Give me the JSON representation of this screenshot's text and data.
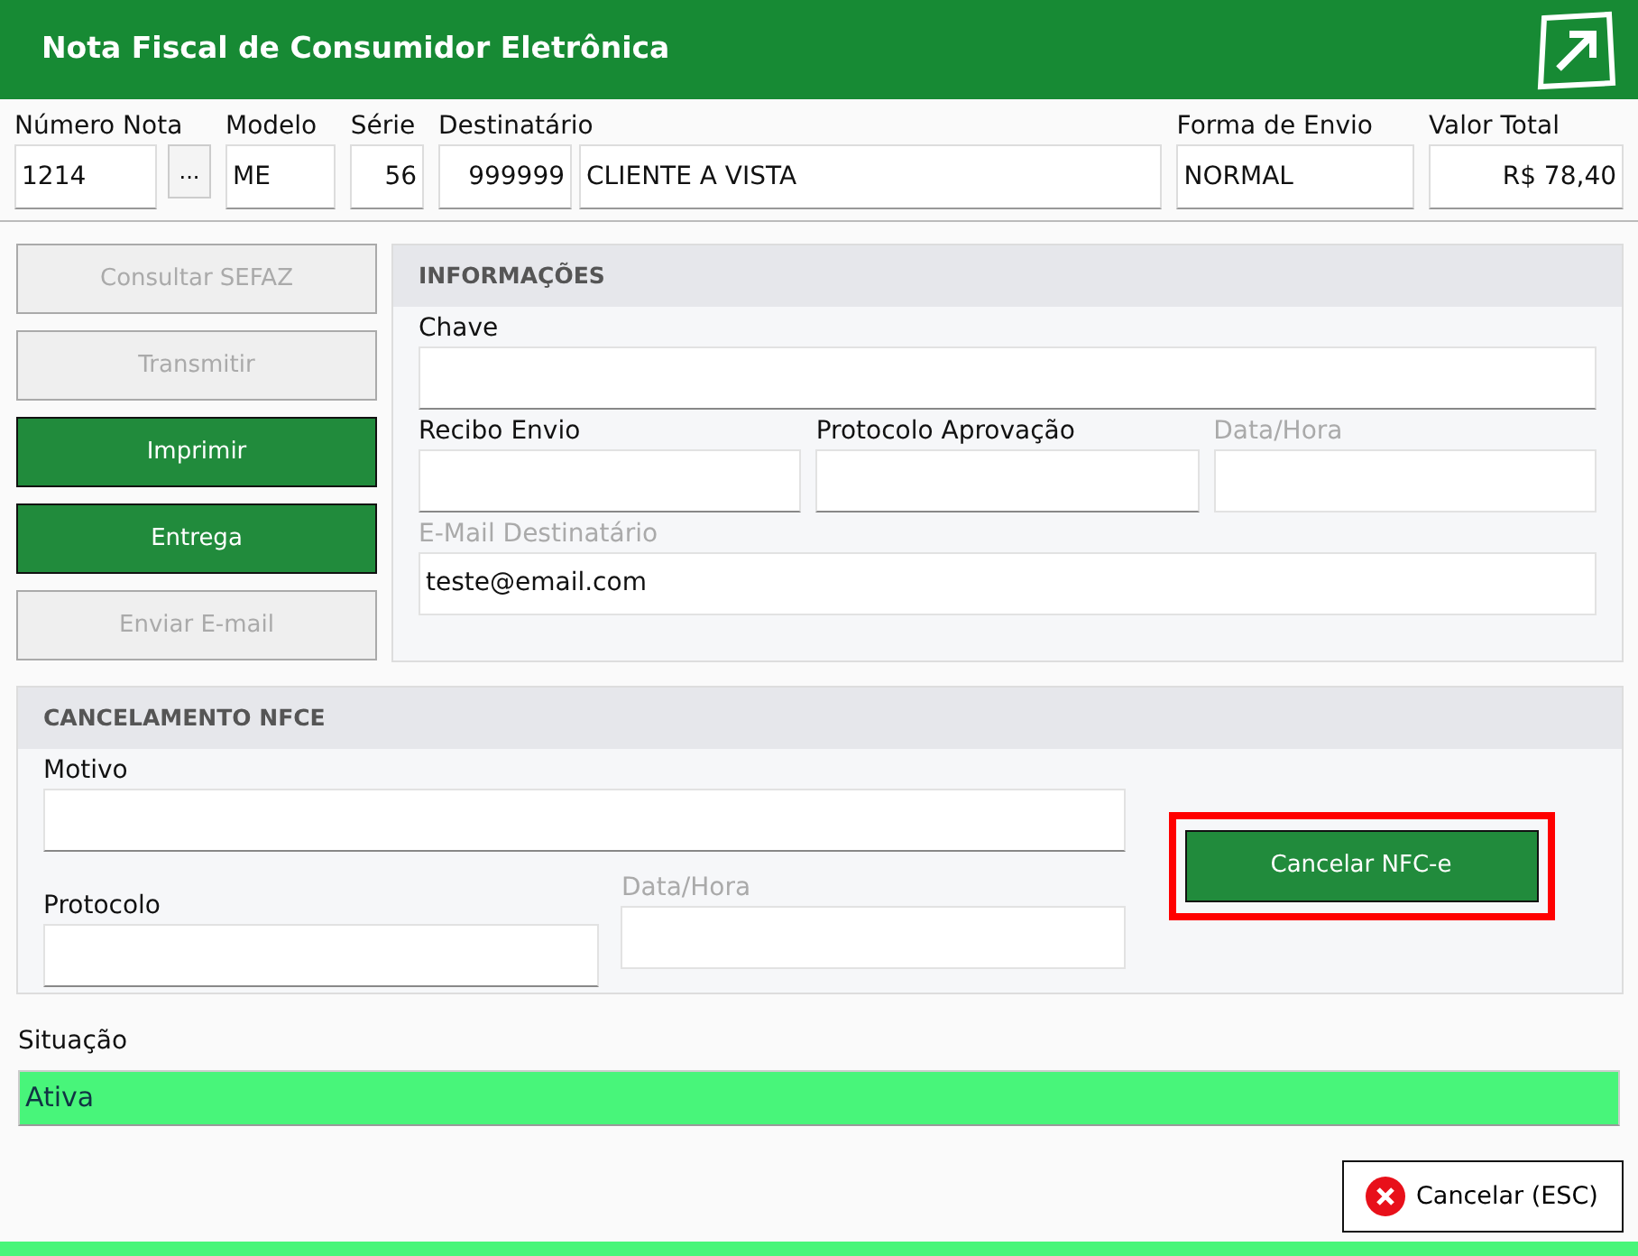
{
  "window": {
    "title": "Nota Fiscal de Consumidor Eletrônica"
  },
  "header_fields": [
    {
      "label": "Número Nota",
      "value": "1214",
      "kind": "lookup",
      "lookup_button": "..."
    },
    {
      "label": "Modelo",
      "value": "ME",
      "kind": "text"
    },
    {
      "label": "Série",
      "value": "56",
      "kind": "number"
    },
    {
      "label": "Destinatário",
      "value": "999999",
      "name": "CLIENTE A VISTA",
      "kind": "pair"
    },
    {
      "label": "Forma de Envio",
      "value": "NORMAL",
      "kind": "text"
    },
    {
      "label": "Valor Total",
      "value": "R$ 78,40",
      "kind": "number"
    }
  ],
  "actions": [
    {
      "label": "Consultar SEFAZ",
      "disabled": true
    },
    {
      "label": "Transmitir",
      "disabled": true
    },
    {
      "label": "Imprimir",
      "disabled": false
    },
    {
      "label": "Entrega",
      "disabled": false
    },
    {
      "label": "Enviar E-mail",
      "disabled": true
    }
  ],
  "informacoes": {
    "title": "INFORMAÇÕES",
    "rows": [
      [
        {
          "label": "Chave",
          "disabled": false
        }
      ],
      [
        {
          "label": "Recibo Envio",
          "disabled": false
        },
        {
          "label": "Protocolo Aprovação",
          "disabled": false
        },
        {
          "label": "Data/Hora",
          "disabled": true
        }
      ],
      [
        {
          "label": "E-Mail Destinatário",
          "value": "teste@email.com",
          "disabled": true
        }
      ]
    ]
  },
  "cancelamento": {
    "title": "CANCELAMENTO NFCE",
    "motivo": {
      "label": "Motivo",
      "disabled": false
    },
    "protocolo": {
      "label": "Protocolo",
      "disabled": false
    },
    "data_hora": {
      "label": "Data/Hora",
      "disabled": true
    },
    "button": {
      "label": "Cancelar NFC-e",
      "highlighted": true
    }
  },
  "situacao": {
    "label": "Situação",
    "value": "Ativa",
    "color": "#48f57a"
  },
  "footer_button": {
    "label": "Cancelar (ESC)"
  }
}
